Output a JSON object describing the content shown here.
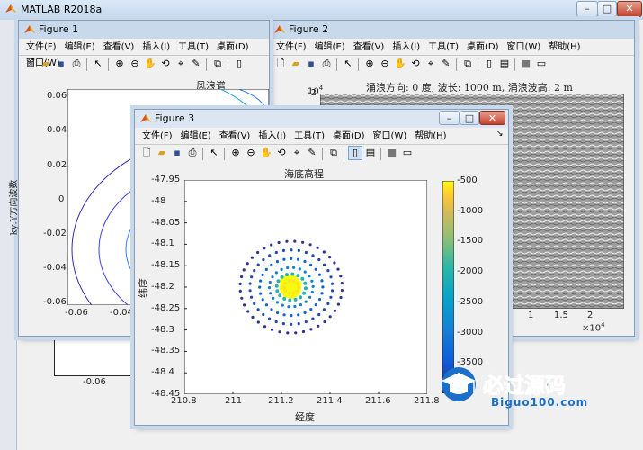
{
  "main": {
    "title": "MATLAB R2018a",
    "bottom_tick": "-0.06"
  },
  "menus": [
    "文件(F)",
    "编辑(E)",
    "查看(V)",
    "插入(I)",
    "工具(T)",
    "桌面(D)",
    "窗口(W)",
    "帮助(H)"
  ],
  "toolbar_icons": [
    "new-file-icon",
    "open-folder-icon",
    "save-icon",
    "print-icon",
    "pointer-icon",
    "zoom-in-icon",
    "zoom-out-icon",
    "pan-hand-icon",
    "rotate-3d-icon",
    "data-cursor-icon",
    "brush-icon",
    "link-icon",
    "colorbar-toggle-icon",
    "legend-toggle-icon",
    "hide-plot-tools-icon",
    "show-plot-tools-icon"
  ],
  "fig1": {
    "title": "Figure 1",
    "menus": [
      "文件(F)",
      "编辑(E)",
      "查看(V)",
      "插入(I)",
      "工具(T)",
      "桌面(D)",
      "窗口(W)"
    ],
    "chart_data": {
      "type": "contour",
      "title": "风浪谱",
      "ylabel": "ky:Y方向波数",
      "yticks": [
        "0.06",
        "0.04",
        "0.02",
        "0",
        "-0.02",
        "-0.04",
        "-0.06"
      ],
      "xticks": [
        "-0.06",
        "-0.04"
      ]
    }
  },
  "fig2": {
    "title": "Figure 2",
    "chart_data": {
      "type": "heatmap",
      "title": "涌浪方向: 0 度, 波长: 1000 m, 涌浪波高: 2 m",
      "y_exponent_base": "10",
      "y_exponent_power": "4",
      "ytick_top": "-2",
      "xticks": [
        "1",
        "1.5",
        "2"
      ],
      "x_exponent_base": "10",
      "x_exponent_power": "4"
    }
  },
  "fig3": {
    "title": "Figure 3",
    "chart_data": {
      "type": "scatter",
      "title": "海底高程",
      "xlabel": "经度",
      "ylabel": "纬度",
      "xlim": [
        210.8,
        211.8
      ],
      "ylim": [
        -48.45,
        -47.95
      ],
      "xticks": [
        "210.8",
        "211",
        "211.2",
        "211.4",
        "211.6",
        "211.8"
      ],
      "yticks": [
        "-47.95",
        "-48",
        "-48.05",
        "-48.1",
        "-48.15",
        "-48.2",
        "-48.25",
        "-48.3",
        "-48.35",
        "-48.4",
        "-48.45"
      ],
      "center": [
        211.24,
        -48.2
      ],
      "rings": [
        {
          "radius": 0.03,
          "value": -600
        },
        {
          "radius": 0.06,
          "value": -2000
        },
        {
          "radius": 0.09,
          "value": -3000
        },
        {
          "radius": 0.13,
          "value": -3400
        },
        {
          "radius": 0.17,
          "value": -3700
        },
        {
          "radius": 0.21,
          "value": -3900
        }
      ],
      "colorbar_ticks": [
        "-500",
        "-1000",
        "-1500",
        "-2000",
        "-2500",
        "-3000",
        "-3500"
      ],
      "clim": [
        -4000,
        -500
      ],
      "colormap": "parula"
    }
  },
  "watermark": {
    "cn": "必过源码",
    "url": "Biguo100.com"
  }
}
